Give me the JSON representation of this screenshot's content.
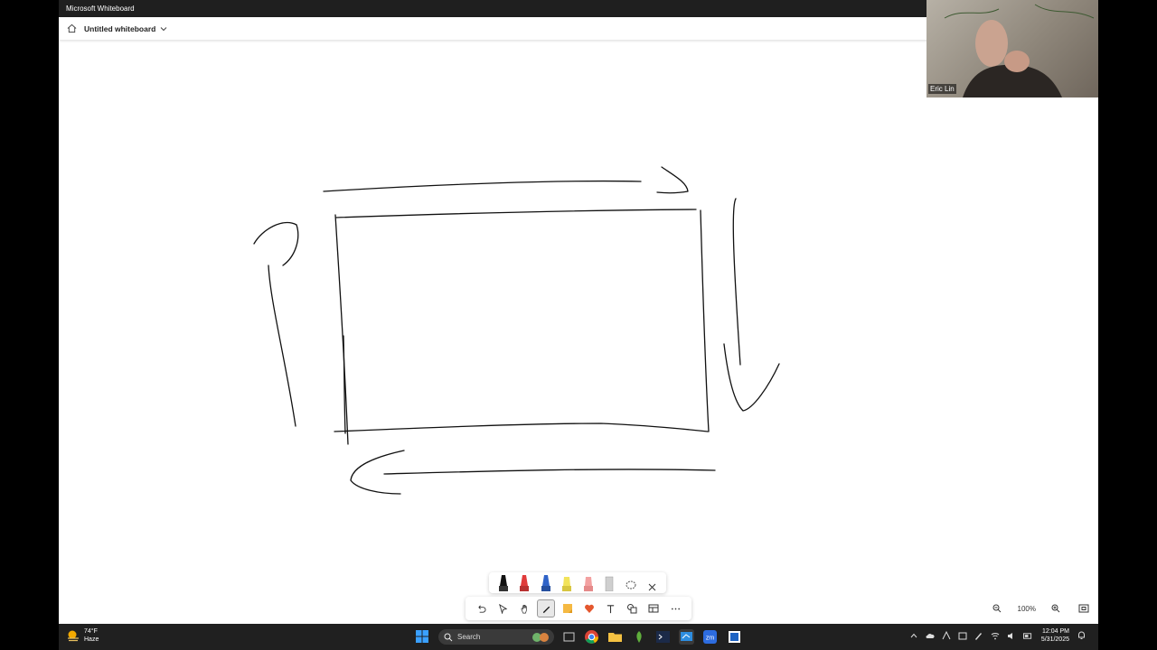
{
  "window": {
    "title": "Microsoft Whiteboard"
  },
  "header": {
    "board_title": "Untitled whiteboard"
  },
  "video": {
    "participant_name": "Eric Lin"
  },
  "pen_tray": {
    "pens": [
      {
        "name": "black-pen",
        "color": "#111111"
      },
      {
        "name": "red-pen",
        "color": "#e03a3a"
      },
      {
        "name": "blue-pen",
        "color": "#2f63c8"
      },
      {
        "name": "yellow-highlighter",
        "color": "#f2e35a"
      },
      {
        "name": "pink-pen",
        "color": "#f3a1a1"
      },
      {
        "name": "eraser",
        "color": "#cfcfcf"
      }
    ]
  },
  "zoom": {
    "level": "100%"
  },
  "taskbar": {
    "weather_temp": "74°F",
    "weather_desc": "Haze",
    "search_label": "Search",
    "time": "12:04 PM",
    "date": "5/31/2025"
  },
  "colors": {
    "accent": "#0078d4",
    "ink": "#111111"
  }
}
